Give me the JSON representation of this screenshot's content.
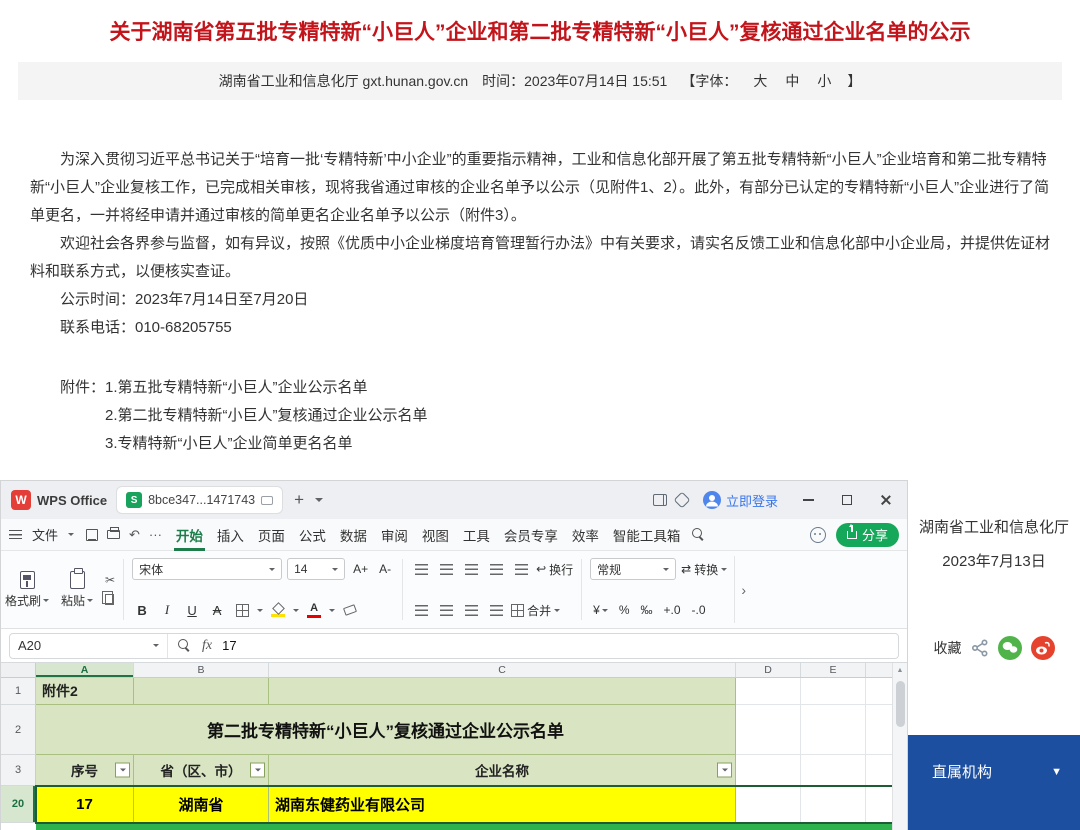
{
  "article": {
    "title": "关于湖南省第五批专精特新“小巨人”企业和第二批专精特新“小巨人”复核通过企业名单的公示",
    "meta": {
      "source": "湖南省工业和信息化厅 gxt.hunan.gov.cn",
      "time_label": "时间：2023年07月14日 15:51",
      "font_label": "【字体：",
      "font_sizes": [
        "大",
        "中",
        "小"
      ],
      "font_label_end": "】"
    },
    "paragraphs": [
      "为深入贯彻习近平总书记关于“培育一批‘专精特新’中小企业”的重要指示精神，工业和信息化部开展了第五批专精特新“小巨人”企业培育和第二批专精特新“小巨人”企业复核工作，已完成相关审核，现将我省通过审核的企业名单予以公示（见附件1、2）。此外，有部分已认定的专精特新“小巨人”企业进行了简单更名，一并将经申请并通过审核的简单更名企业名单予以公示（附件3）。",
      "欢迎社会各界参与监督，如有异议，按照《优质中小企业梯度培育管理暂行办法》中有关要求，请实名反馈工业和信息化部中小企业局，并提供佐证材料和联系方式，以便核实查证。"
    ],
    "publicity_time": "公示时间：2023年7月14日至7月20日",
    "contact_phone": "联系电话：010-68205755",
    "attachments_label": "附件：",
    "attachments": [
      "1.第五批专精特新“小巨人”企业公示名单",
      "2.第二批专精特新“小巨人”复核通过企业公示名单",
      "3.专精特新“小巨人”企业简单更名名单"
    ]
  },
  "wps": {
    "titlebar": {
      "logo_letter": "W",
      "brand": "WPS Office",
      "doc_icon_letter": "S",
      "doc_tab": "8bce347...1471743",
      "new_tab": "+",
      "login": "立即登录"
    },
    "menubar": {
      "file": "文件",
      "tabs": [
        "开始",
        "插入",
        "页面",
        "公式",
        "数据",
        "审阅",
        "视图",
        "工具",
        "会员专享",
        "效率",
        "智能工具箱"
      ],
      "active_tab": "开始",
      "share": "分享"
    },
    "toolbar": {
      "format_painter": "格式刷",
      "paste": "粘贴",
      "font_name": "宋体",
      "font_size": "14",
      "grow": "A+",
      "shrink": "A-",
      "bold": "B",
      "italic": "I",
      "underline": "U",
      "strike": "A",
      "font_color_letter": "A",
      "wrap": "换行",
      "merge": "合并",
      "number_format": "常规",
      "convert": "转换",
      "currency": "¥",
      "percent": "%",
      "permille": "‰",
      "dec_inc": "+.0",
      "dec_dec": "-.0"
    },
    "formula_bar": {
      "cell_ref": "A20",
      "fx": "fx",
      "value": "17"
    },
    "sheet": {
      "col_headers": [
        "A",
        "B",
        "C",
        "D",
        "E"
      ],
      "row_numbers": [
        "1",
        "2",
        "3",
        "20"
      ],
      "a1": "附件2",
      "table_title": "第二批专精特新“小巨人”复核通过企业公示名单",
      "headers": [
        "序号",
        "省（区、市）",
        "企业名称"
      ],
      "data_row": [
        "17",
        "湖南省",
        "湖南东健药业有限公司"
      ]
    }
  },
  "sidebar": {
    "org": "湖南省工业和信息化厅",
    "date": "2023年7月13日",
    "favorite": "收藏",
    "directory": "直属机构"
  },
  "icons": {
    "scissors": "✂",
    "undo": "↶",
    "more": "···",
    "wrap_icon": "↩",
    "convert_icon": "⇄",
    "chevron_more": "›",
    "triangle_down": "▼",
    "scroll_up": "▲"
  },
  "colors": {
    "title_red": "#c2151b",
    "wps_green": "#1d7d4a",
    "table_fill_green": "#d9e5c2",
    "highlight_yellow": "#ffff00",
    "strip_green": "#2eb24e",
    "directory_blue": "#1d4fa1"
  }
}
